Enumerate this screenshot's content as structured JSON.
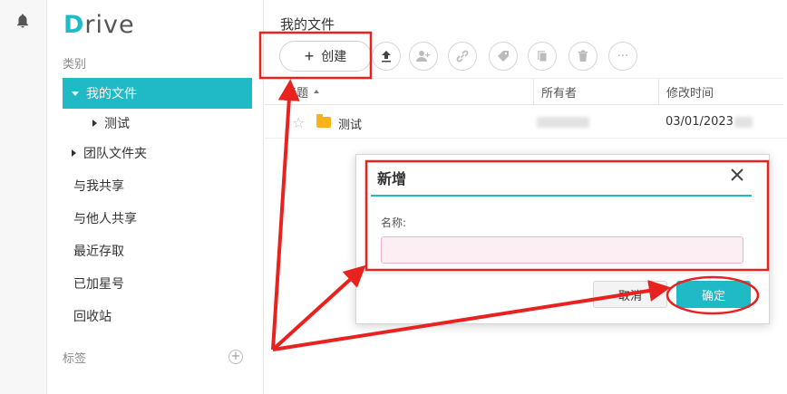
{
  "app": {
    "logo_first": "D",
    "logo_rest": "rive"
  },
  "sidebar": {
    "category_label": "类别",
    "items": [
      {
        "label": "我的文件"
      },
      {
        "label": "测试"
      },
      {
        "label": "团队文件夹"
      },
      {
        "label": "与我共享"
      },
      {
        "label": "与他人共享"
      },
      {
        "label": "最近存取"
      },
      {
        "label": "已加星号"
      },
      {
        "label": "回收站"
      }
    ],
    "tags_label": "标签",
    "add_tag_glyph": "+"
  },
  "main": {
    "title": "我的文件",
    "create_label": "创建",
    "toolbar_icons": [
      "upload-icon",
      "add-user-icon",
      "link-icon",
      "tag-icon",
      "copy-icon",
      "trash-icon",
      "more-icon"
    ],
    "more_glyph": "···",
    "table": {
      "columns": [
        "标题",
        "所有者",
        "修改时间"
      ],
      "rows": [
        {
          "name": "测试",
          "modified": "03/01/2023"
        }
      ]
    }
  },
  "dialog": {
    "title": "新增",
    "name_label": "名称:",
    "name_value": "",
    "cancel_label": "取消",
    "ok_label": "确定"
  },
  "colors": {
    "accent": "#1fbac6",
    "annotation": "#e8231f"
  }
}
